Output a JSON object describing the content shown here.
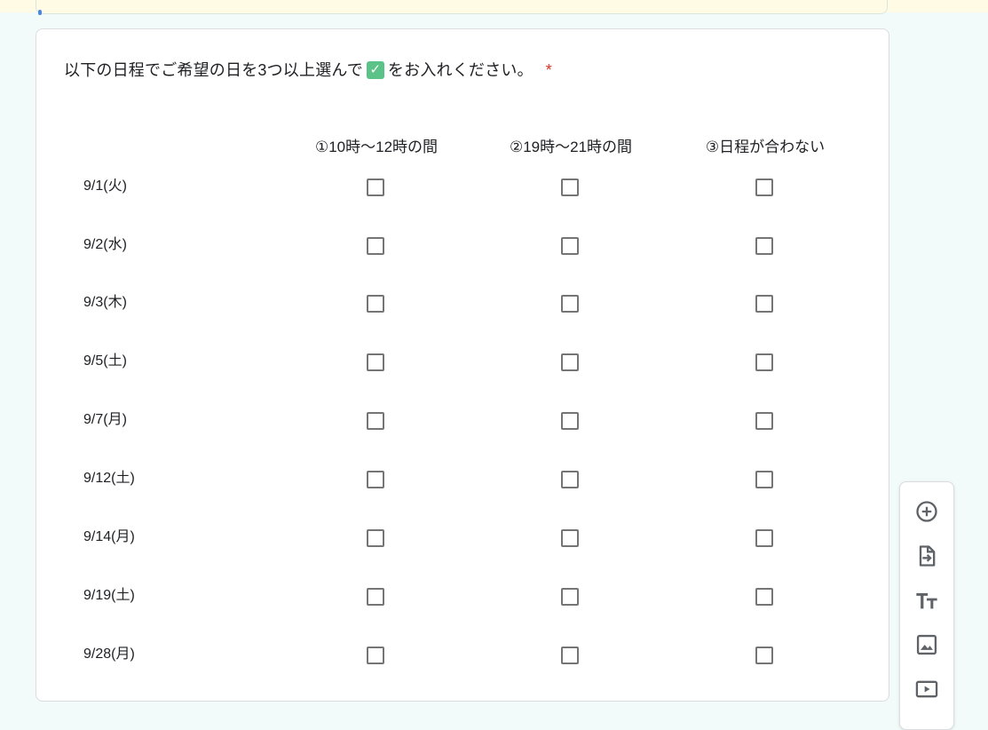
{
  "question": {
    "text_before": "以下の日程でご希望の日を3つ以上選んで",
    "check_symbol": "✓",
    "text_after": "をお入れください。",
    "required_mark": "*"
  },
  "columns": [
    "①10時〜12時の間",
    "②19時〜21時の間",
    "③日程が合わない"
  ],
  "rows": [
    "9/1(火)",
    "9/2(水)",
    "9/3(木)",
    "9/5(土)",
    "9/7(月)",
    "9/12(土)",
    "9/14(月)",
    "9/19(土)",
    "9/28(月)"
  ],
  "checked": [
    [
      false,
      false,
      false
    ],
    [
      false,
      false,
      false
    ],
    [
      false,
      false,
      false
    ],
    [
      false,
      false,
      false
    ],
    [
      false,
      false,
      false
    ],
    [
      false,
      false,
      false
    ],
    [
      false,
      false,
      false
    ],
    [
      false,
      false,
      false
    ],
    [
      false,
      false,
      false
    ]
  ],
  "toolbar": {
    "icons": [
      "add-question-icon",
      "import-questions-icon",
      "add-title-icon",
      "add-image-icon",
      "add-video-icon"
    ]
  },
  "colors": {
    "page_bg": "#f2fbf9",
    "prev_card_bg": "#fffbe5",
    "required": "#d93025",
    "checkbox_border": "#757575",
    "check_emoji_bg": "#5bc387"
  }
}
